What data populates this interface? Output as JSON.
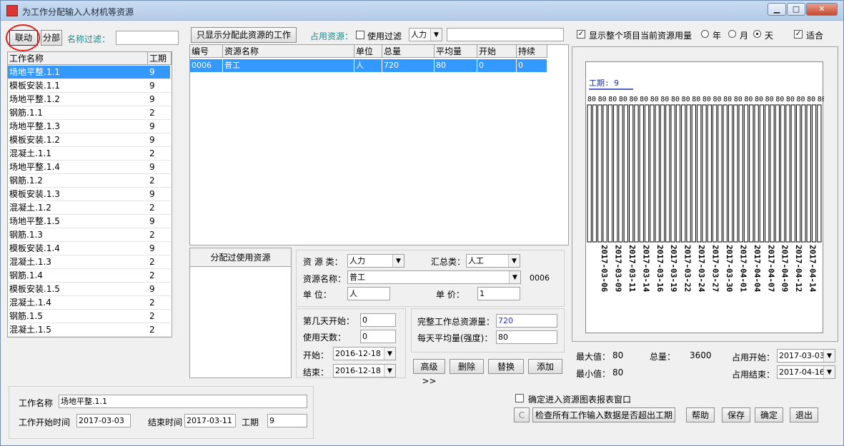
{
  "window": {
    "title": "为工作分配输入人材机等资源",
    "min_label": "▁",
    "max_label": "□",
    "close_label": "✕"
  },
  "left": {
    "linked_button": "联动",
    "partial_button": "分部",
    "filter_label": "名称过滤：",
    "filter_value": "",
    "columns": [
      "工作名称",
      "工期"
    ],
    "rows": [
      {
        "name": "场地平整.1.1",
        "days": "9"
      },
      {
        "name": "模板安装.1.1",
        "days": "9"
      },
      {
        "name": "场地平整.1.2",
        "days": "9"
      },
      {
        "name": "钢筋.1.1",
        "days": "2"
      },
      {
        "name": "场地平整.1.3",
        "days": "9"
      },
      {
        "name": "模板安装.1.2",
        "days": "9"
      },
      {
        "name": "混凝土.1.1",
        "days": "2"
      },
      {
        "name": "场地平整.1.4",
        "days": "9"
      },
      {
        "name": "钢筋.1.2",
        "days": "2"
      },
      {
        "name": "模板安装.1.3",
        "days": "9"
      },
      {
        "name": "混凝土.1.2",
        "days": "2"
      },
      {
        "name": "场地平整.1.5",
        "days": "9"
      },
      {
        "name": "钢筋.1.3",
        "days": "2"
      },
      {
        "name": "模板安装.1.4",
        "days": "9"
      },
      {
        "name": "混凝土.1.3",
        "days": "2"
      },
      {
        "name": "钢筋.1.4",
        "days": "2"
      },
      {
        "name": "模板安装.1.5",
        "days": "9"
      },
      {
        "name": "混凝土.1.4",
        "days": "2"
      },
      {
        "name": "钢筋.1.5",
        "days": "2"
      },
      {
        "name": "混凝土.1.5",
        "days": "2"
      }
    ]
  },
  "middle": {
    "show_only_button": "只显示分配此资源的工作",
    "occupy_label": "占用资源：",
    "use_filter_label": "使用过滤",
    "type_select": "人力",
    "filter_text": "",
    "columns": [
      "编号",
      "资源名称",
      "单位",
      "总量",
      "平均量",
      "开始",
      "持续"
    ],
    "rows": [
      {
        "id": "0006",
        "name": "普工",
        "unit": "人",
        "total": "720",
        "avg": "80",
        "start": "0",
        "dur": "0"
      }
    ],
    "used_header": "分配过使用资源",
    "resource_type_label": "资 源 类：",
    "resource_type": "人力",
    "summary_type_label": "汇总类：",
    "summary_type": "人工",
    "resource_name_label": "资源名称：",
    "resource_name": "普工",
    "resource_code": "0006",
    "unit_label": "单    位：",
    "unit": "人",
    "price_label": "单    价：",
    "price": "1",
    "start_day_label": "第几天开始：",
    "start_day": "0",
    "use_days_label": "使用天数：",
    "use_days": "0",
    "start_label": "开始：",
    "start_date": "2016-12-18",
    "end_label": "结束：",
    "end_date": "2016-12-18",
    "total_usage_label": "完整工作总资源量：",
    "total_usage": "720",
    "daily_avg_label": "每天平均量(强度)：",
    "daily_avg": "80",
    "advanced_button": "高级>>",
    "delete_button": "删除",
    "replace_button": "替换",
    "add_button": "添加"
  },
  "right": {
    "show_project_label": "显示整个项目当前资源用量",
    "year_label": "年",
    "month_label": "月",
    "day_label": "天",
    "fit_label": "适合",
    "max_label": "最大值：",
    "max_value": "80",
    "total_label": "总量：",
    "total_value": "3600",
    "min_label": "最小值：",
    "min_value": "80",
    "occupy_start_label": "占用开始：",
    "occupy_start": "2017-03-03",
    "occupy_end_label": "占用结束：",
    "occupy_end": "2017-04-16"
  },
  "chart_data": {
    "type": "bar",
    "duration_label": "工期: 9",
    "bar_value_label": "80",
    "values": [
      80,
      80,
      80,
      80,
      80,
      80,
      80,
      80,
      80,
      80,
      80,
      80,
      80,
      80,
      80,
      80,
      80,
      80,
      80,
      80,
      80,
      80,
      80,
      80,
      80,
      80,
      80,
      80,
      80,
      80,
      80,
      80,
      80,
      80,
      80,
      80,
      80,
      80,
      80,
      80,
      80,
      80,
      80,
      80,
      80
    ],
    "date_labels": [
      "2017-03-06",
      "2017-03-09",
      "2017-03-11",
      "2017-03-14",
      "2017-03-16",
      "2017-03-19",
      "2017-03-22",
      "2017-03-24",
      "2017-03-27",
      "2017-03-30",
      "2017-04-01",
      "2017-04-04",
      "2017-04-07",
      "2017-04-09",
      "2017-04-12",
      "2017-04-14"
    ]
  },
  "bottom": {
    "work_name_label": "工作名称",
    "work_name": "场地平整.1.1",
    "start_time_label": "工作开始时间",
    "start_time": "2017-03-03",
    "end_time_label": "结束时间",
    "end_time": "2017-03-11",
    "duration_label": "工期",
    "duration": "9",
    "enter_chart_label": "确定进入资源图表报表窗口",
    "c_button": "C",
    "check_button": "检查所有工作输入数据是否超出工期",
    "help_button": "帮助",
    "save_button": "保存",
    "ok_button": "确定",
    "exit_button": "退出"
  }
}
